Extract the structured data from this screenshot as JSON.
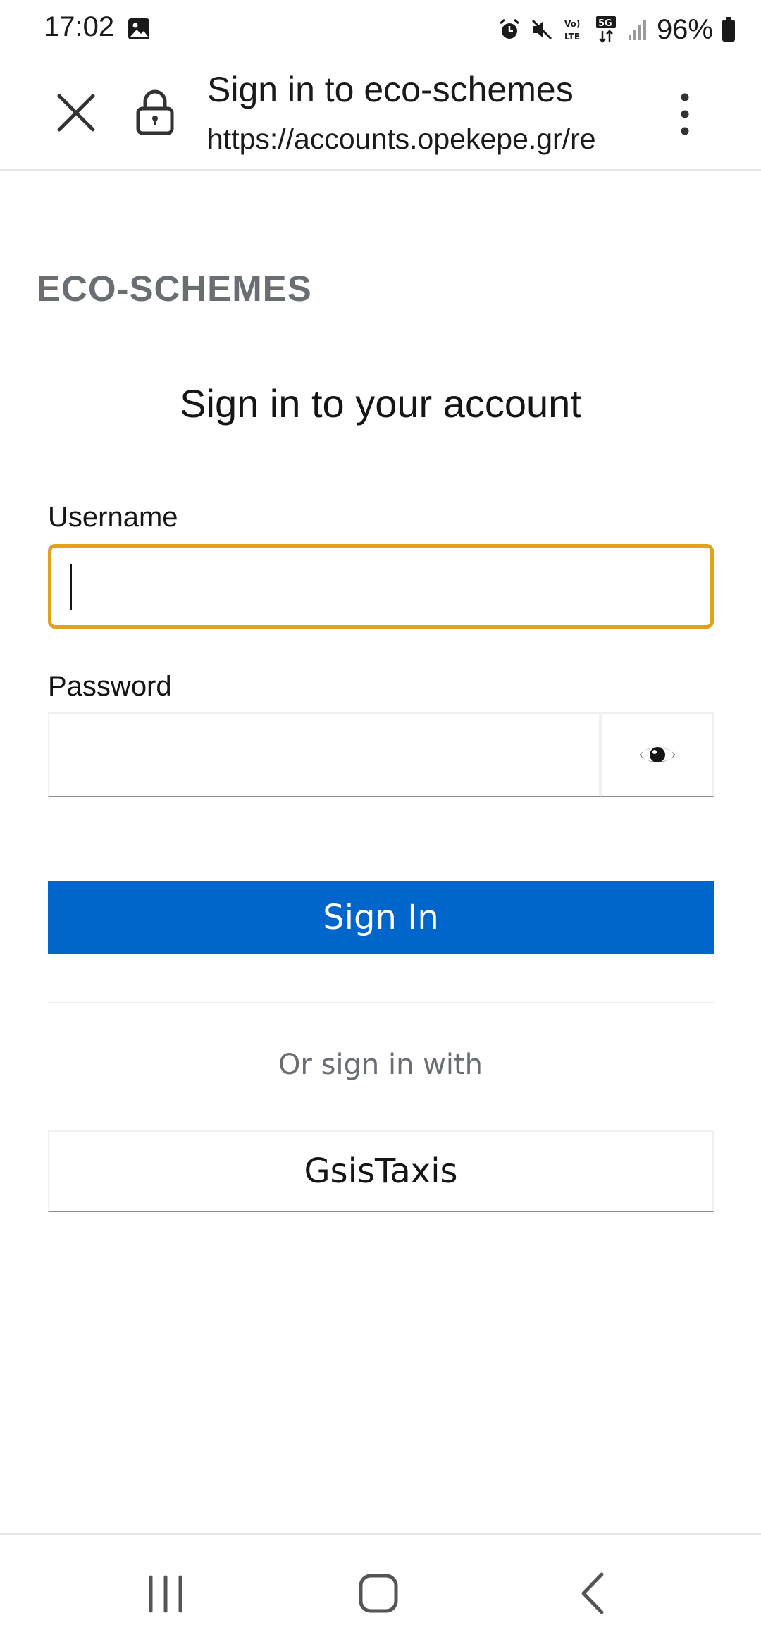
{
  "status_bar": {
    "time": "17:02",
    "battery": "96%",
    "icons": [
      "gallery-icon",
      "alarm-icon",
      "mute-icon",
      "volte-icon",
      "5g-icon",
      "signal-icon",
      "battery-icon"
    ]
  },
  "browser": {
    "title": "Sign in to eco-schemes",
    "url": "https://accounts.opekepe.gr/re",
    "icons": [
      "close-icon",
      "lock-icon",
      "more-vert-icon"
    ]
  },
  "page": {
    "brand": "ECO-SCHEMES",
    "heading": "Sign in to your account",
    "username_label": "Username",
    "username_value": "",
    "password_label": "Password",
    "password_value": "",
    "show_password_icon": "eye-icon",
    "signin_button": "Sign In",
    "alt_signin_text": "Or sign in with",
    "provider_button": "GsisTaxis"
  },
  "colors": {
    "primary": "#0066cc",
    "focus_border": "#e0a11b",
    "brand_text": "#6a6e73"
  },
  "nav_bar": {
    "icons": [
      "recents-icon",
      "home-icon",
      "back-icon"
    ]
  }
}
